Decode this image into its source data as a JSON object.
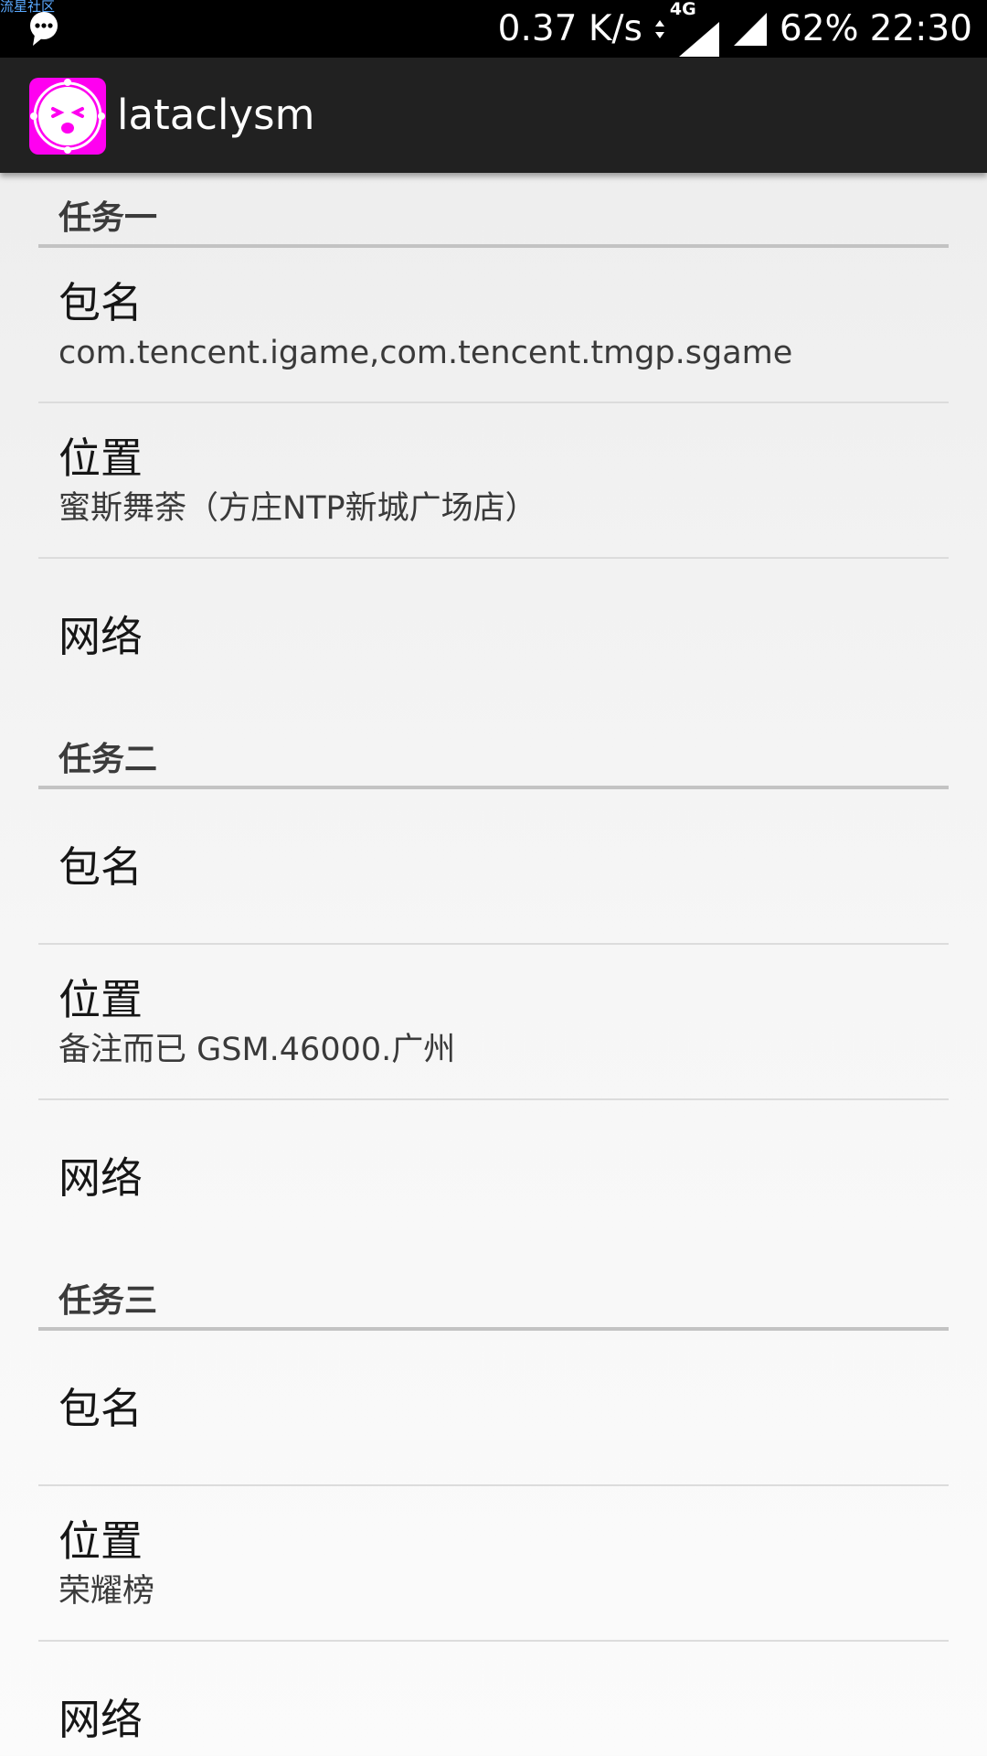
{
  "status_bar": {
    "watermark": "流星社区",
    "speed": "0.37 K/s",
    "network_type": "4G",
    "battery": "62%",
    "time": "22:30"
  },
  "app_bar": {
    "title": "lataclysm",
    "icon_color": "#ff00f0"
  },
  "tasks": [
    {
      "header": "任务一",
      "package_label": "包名",
      "package_value": "com.tencent.igame,com.tencent.tmgp.sgame",
      "location_label": "位置",
      "location_value": "蜜斯舞荼（方庄NTP新城广场店）",
      "network_label": "网络"
    },
    {
      "header": "任务二",
      "package_label": "包名",
      "package_value": "",
      "location_label": "位置",
      "location_value": "备注而已 GSM.46000.广州",
      "network_label": "网络"
    },
    {
      "header": "任务三",
      "package_label": "包名",
      "package_value": "",
      "location_label": "位置",
      "location_value": "荣耀榜",
      "network_label": "网络"
    }
  ]
}
